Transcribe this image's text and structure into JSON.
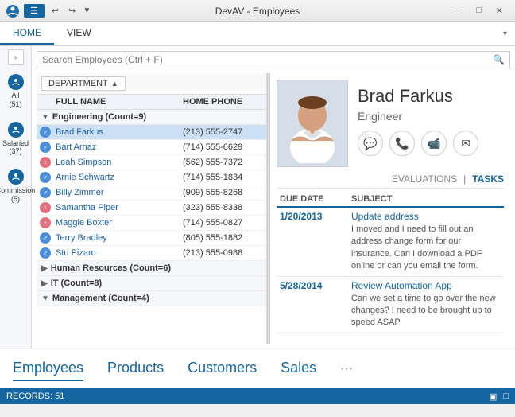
{
  "titlebar": {
    "title": "DevAV - Employees",
    "menu_icon": "☰",
    "quick_actions": [
      "↩",
      "↪",
      "▼"
    ],
    "controls": {
      "minimize": "─",
      "maximize": "□",
      "close": "✕"
    }
  },
  "ribbon": {
    "tabs": [
      "HOME",
      "VIEW"
    ],
    "chevron": "▾"
  },
  "sidebar": {
    "expand": "›",
    "items": [
      {
        "label": "All (51)",
        "id": "all"
      },
      {
        "label": "Salaried (37)",
        "id": "salaried"
      },
      {
        "label": "Commission (5)",
        "id": "commission"
      }
    ]
  },
  "search": {
    "placeholder": "Search Employees (Ctrl + F)"
  },
  "department_sort": {
    "label": "DEPARTMENT",
    "arrow": "▲"
  },
  "table_headers": {
    "icon": "",
    "full_name": "FULL NAME",
    "home_phone": "HOME PHONE"
  },
  "groups": [
    {
      "name": "Engineering (Count=9)",
      "expanded": true,
      "employees": [
        {
          "name": "Brad Farkus",
          "phone": "(213) 555-2747",
          "gender": "male",
          "selected": true
        },
        {
          "name": "Bart Arnaz",
          "phone": "(714) 555-6629",
          "gender": "male"
        },
        {
          "name": "Leah Simpson",
          "phone": "(562) 555-7372",
          "gender": "female"
        },
        {
          "name": "Arnie Schwartz",
          "phone": "(714) 555-1834",
          "gender": "male"
        },
        {
          "name": "Billy Zimmer",
          "phone": "(909) 555-8268",
          "gender": "male"
        },
        {
          "name": "Samantha Piper",
          "phone": "(323) 555-8338",
          "gender": "female"
        },
        {
          "name": "Maggie Boxter",
          "phone": "(714) 555-0827",
          "gender": "female"
        },
        {
          "name": "Terry Bradley",
          "phone": "(805) 555-1882",
          "gender": "male"
        },
        {
          "name": "Stu Pizaro",
          "phone": "(213) 555-0988",
          "gender": "male"
        }
      ]
    },
    {
      "name": "Human Resources (Count=6)",
      "expanded": false,
      "employees": []
    },
    {
      "name": "IT (Count=8)",
      "expanded": false,
      "employees": []
    },
    {
      "name": "Management (Count=4)",
      "expanded": true,
      "employees": []
    }
  ],
  "detail": {
    "employee_name": "Brad Farkus",
    "employee_title": "Engineer",
    "action_icons": [
      "💬",
      "📞",
      "🎥",
      "✉"
    ],
    "tabs": {
      "evaluations": "EVALUATIONS",
      "divider": "|",
      "tasks": "TASKS"
    },
    "tasks_columns": {
      "due_date": "DUE DATE",
      "subject": "SUBJECT"
    },
    "tasks": [
      {
        "date": "1/20/2013",
        "subject": "Update address",
        "description": "I moved and I need to fill out an address change form for our insurance.  Can I download a PDF online or can you email the form."
      },
      {
        "date": "5/28/2014",
        "subject": "Review Automation App",
        "description": "Can we set a time to go over the new changes?  I need to be brought up to speed ASAP"
      }
    ]
  },
  "bottom_tabs": {
    "items": [
      "Employees",
      "Products",
      "Customers",
      "Sales"
    ],
    "active": "Employees",
    "more": "···"
  },
  "statusbar": {
    "records": "RECORDS: 51",
    "icons": [
      "▣",
      "□"
    ]
  }
}
